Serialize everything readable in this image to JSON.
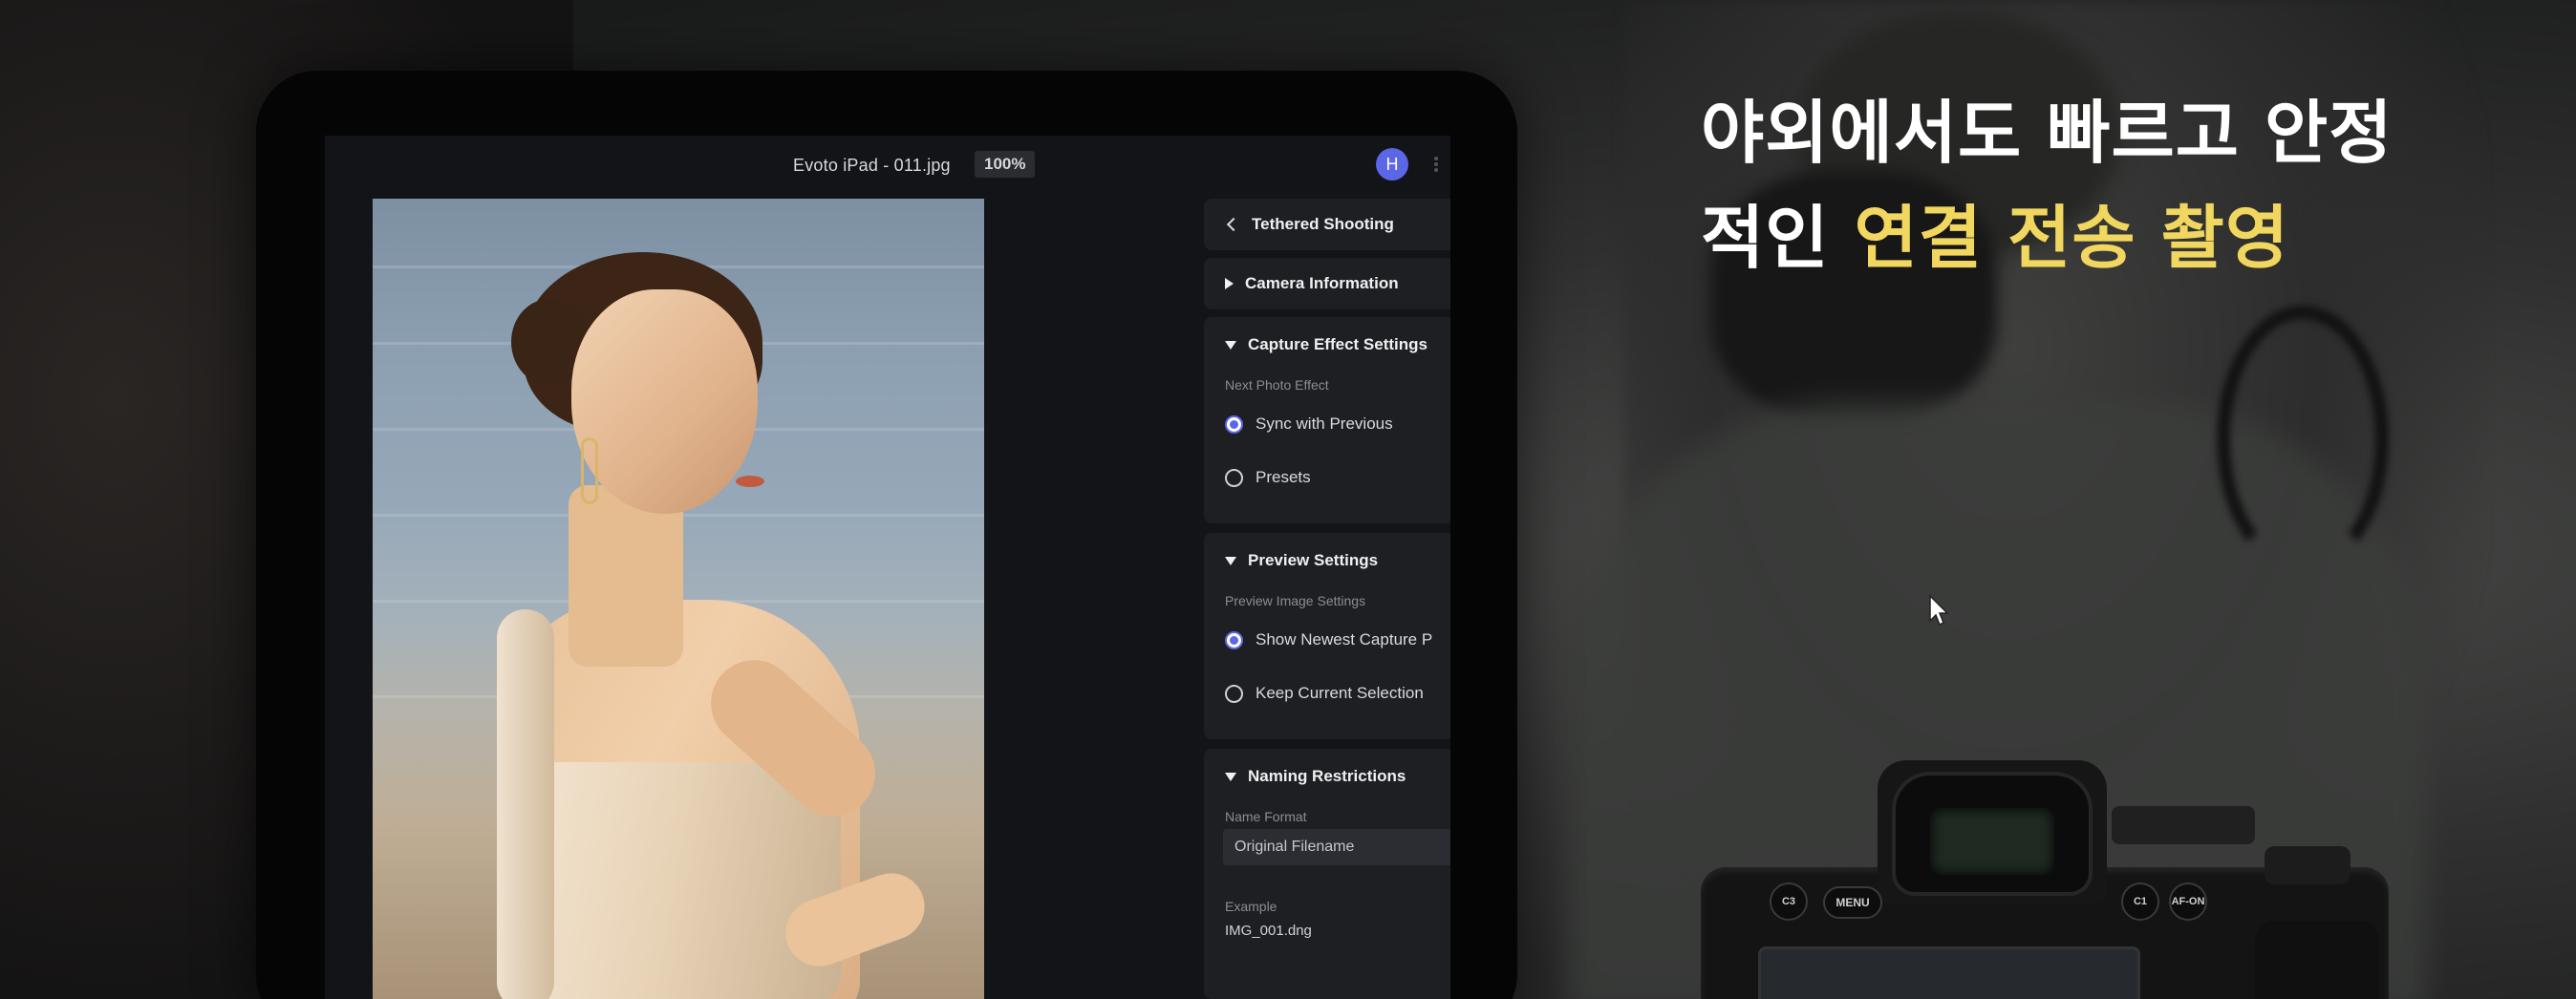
{
  "app": {
    "file_title": "Evoto iPad - 011.jpg",
    "zoom": "100%",
    "avatar_initial": "H"
  },
  "panel": {
    "back_label": "Tethered Shooting",
    "camera_info": "Camera Information",
    "capture_effect": {
      "title": "Capture Effect Settings",
      "sub_label": "Next Photo Effect",
      "options": [
        "Sync with Previous",
        "Presets"
      ],
      "selected": "Sync with Previous"
    },
    "preview": {
      "title": "Preview Settings",
      "sub_label": "Preview Image Settings",
      "options": [
        "Show Newest Capture P",
        "Keep Current Selection"
      ],
      "selected": "Show Newest Capture P"
    },
    "naming": {
      "title": "Naming Restrictions",
      "format_label": "Name Format",
      "format_value": "Original Filename",
      "example_label": "Example",
      "example_value": "IMG_001.dng"
    }
  },
  "headline": {
    "line1": "야외에서도 빠르고 안정",
    "line2_plain": "적인 ",
    "line2_accent": "연결 전송 촬영"
  },
  "camera": {
    "buttons": [
      "C3",
      "MENU",
      "C1",
      "AF-ON"
    ]
  },
  "colors": {
    "accent": "#5b67e6",
    "headline_accent": "#f1d65f",
    "panel_bg": "#1e1f23",
    "screen_bg": "#131417"
  }
}
